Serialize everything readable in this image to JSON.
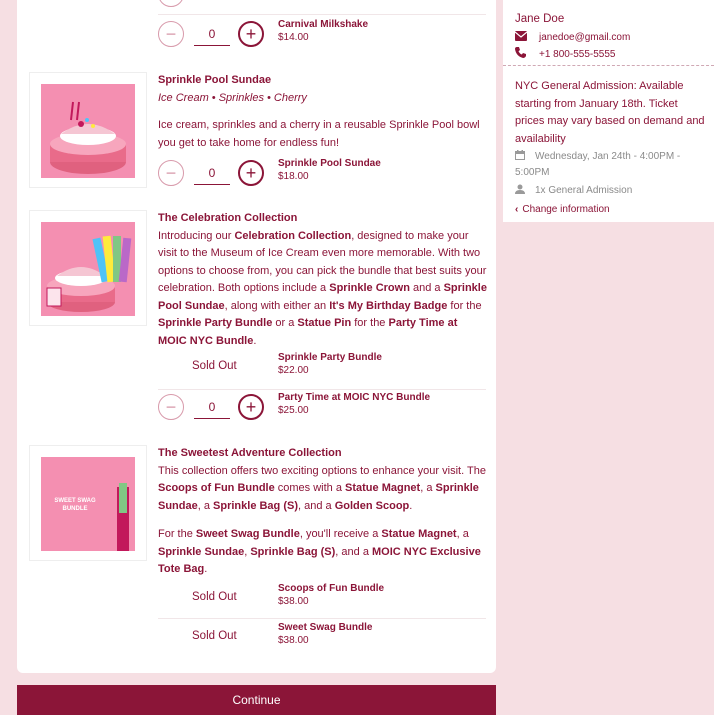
{
  "products": [
    {
      "options": [
        {
          "name": "Carnival Milkshake",
          "price": "$14.00",
          "qty": "0"
        }
      ]
    },
    {
      "title": "Sprinkle Pool Sundae",
      "subtitle": "Ice Cream • Sprinkles • Cherry",
      "desc": "Ice cream, sprinkles and a cherry in a reusable Sprinkle Pool bowl you get to take home for endless fun!",
      "options": [
        {
          "name": "Sprinkle Pool Sundae",
          "price": "$18.00",
          "qty": "0"
        }
      ]
    },
    {
      "title": "The Celebration Collection",
      "desc_parts": [
        "Introducing our ",
        "Celebration Collection",
        ", designed to make your visit to the Museum of Ice Cream even more memorable. With two options to choose from, you can pick the bundle that best suits your celebration. Both options include a ",
        "Sprinkle Crown",
        " and a ",
        "Sprinkle Pool Sundae",
        ", along with either an ",
        "It's My Birthday Badge",
        " for the ",
        "Sprinkle Party Bundle",
        " or a ",
        "Statue Pin",
        " for the ",
        "Party Time at MOIC NYC Bundle",
        "."
      ],
      "options": [
        {
          "name": "Sprinkle Party Bundle",
          "price": "$22.00",
          "status": "Sold Out"
        },
        {
          "name": "Party Time at MOIC NYC Bundle",
          "price": "$25.00",
          "qty": "0"
        }
      ]
    },
    {
      "title": "The Sweetest Adventure Collection",
      "image_text": "SWEET SWAG BUNDLE",
      "desc_parts": [
        "This collection offers two exciting options to enhance your visit. The ",
        "Scoops of Fun Bundle",
        " comes with a ",
        "Statue Magnet",
        ", a ",
        "Sprinkle Sundae",
        ", a ",
        "Sprinkle Bag (S)",
        ", and a ",
        "Golden Scoop",
        "."
      ],
      "desc2_parts": [
        "For the ",
        "Sweet Swag Bundle",
        ", you'll receive a ",
        "Statue Magnet",
        ", a ",
        "Sprinkle Sundae",
        ", ",
        "Sprinkle Bag (S)",
        ", and a ",
        "MOIC NYC Exclusive Tote Bag",
        "."
      ],
      "options": [
        {
          "name": "Scoops of Fun Bundle",
          "price": "$38.00",
          "status": "Sold Out"
        },
        {
          "name": "Sweet Swag Bundle",
          "price": "$38.00",
          "status": "Sold Out"
        }
      ]
    }
  ],
  "continue_label": "Continue",
  "sidebar": {
    "name": "Jane Doe",
    "email": "janedoe@gmail.com",
    "phone": "+1 800-555-5555",
    "event": "NYC General Admission: Available starting from January 18th. Ticket prices may vary based on demand and availability",
    "date": "Wednesday, Jan 24th - 4:00PM - 5:00PM",
    "admission": "1x General Admission",
    "change": "Change information",
    "icons": {
      "email": "envelope-icon",
      "phone": "phone-icon",
      "date": "calendar-icon",
      "admission": "person-icon",
      "change": "chevron-left-icon"
    }
  },
  "colors": {
    "accent": "#8b1538",
    "background": "#f6dfe3",
    "image_pink": "#f48fb1"
  }
}
